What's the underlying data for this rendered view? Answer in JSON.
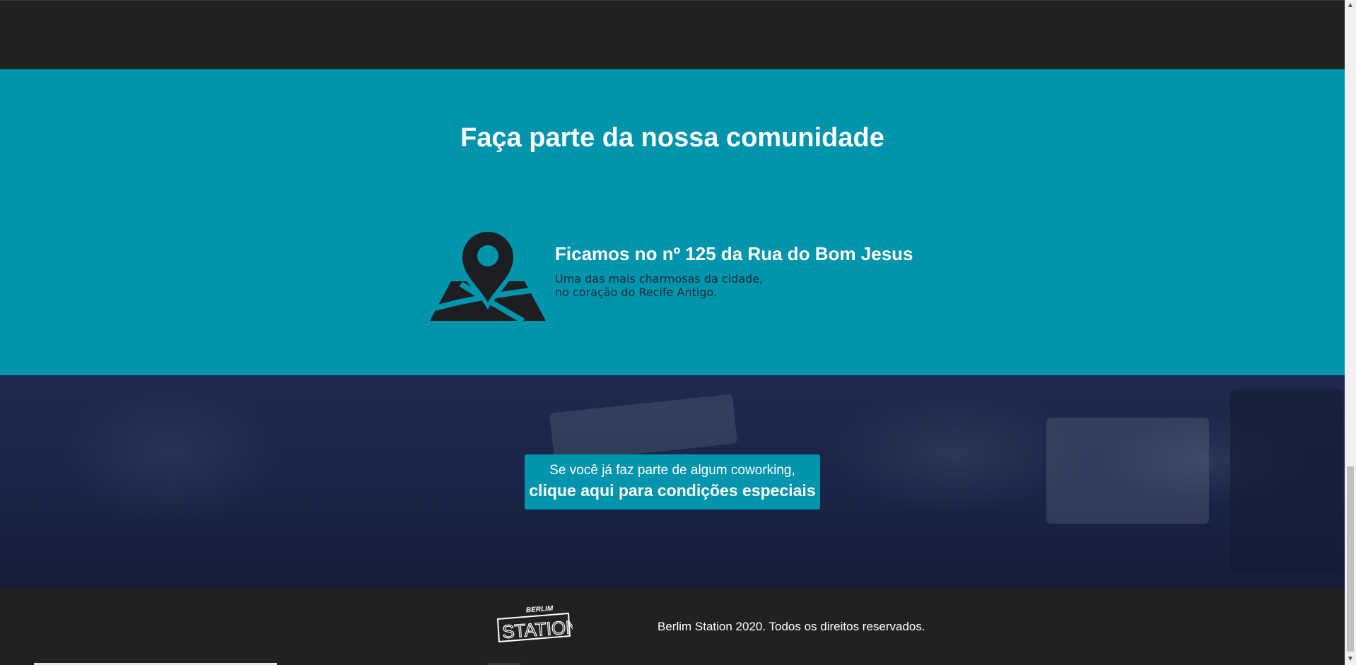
{
  "community": {
    "title": "Faça parte da nossa comunidade",
    "location_title": "Ficamos no nº 125 da Rua do Bom Jesus",
    "location_desc_line1": "Uma das mais charmosas da cidade,",
    "location_desc_line2": "no coração do Recife Antigo."
  },
  "cta": {
    "line1": "Se você já faz parte de algum coworking,",
    "line2": "clique aqui para condições especiais"
  },
  "footer": {
    "logo_top": "BERLIM",
    "logo_main": "STATION",
    "copyright": "Berlim Station 2020. Todos os direitos reservados."
  },
  "colors": {
    "accent": "#0094ad",
    "dark": "#212121",
    "hero": "#1e2a4c"
  },
  "icons": {
    "location": "map-pin-icon",
    "scroll_up": "scroll-up-arrow-icon",
    "scroll_down": "scroll-down-arrow-icon"
  }
}
